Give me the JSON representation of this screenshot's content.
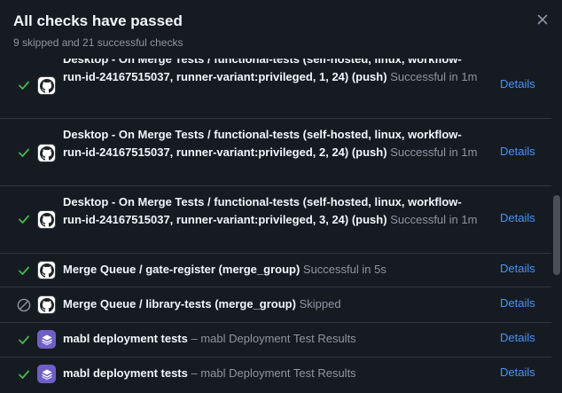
{
  "header": {
    "title": "All checks have passed",
    "subtitle": "9 skipped and 21 successful checks",
    "close_icon": "x-icon"
  },
  "colors": {
    "background": "#161b22",
    "success": "#3fb950",
    "skipped": "#8d96a0",
    "link": "#4493f8",
    "mabl": "#6e5fc7"
  },
  "checks": [
    {
      "status": "success",
      "avatar": "github-icon",
      "name": "Desktop - On Merge Tests / functional-tests (self-hosted, linux, workflow-run-id-24167515037, runner-variant:privileged, 1, 24) (push)",
      "desc": "Successful in 1m",
      "details": "Details"
    },
    {
      "status": "success",
      "avatar": "github-icon",
      "name": "Desktop - On Merge Tests / functional-tests (self-hosted, linux, workflow-run-id-24167515037, runner-variant:privileged, 2, 24) (push)",
      "desc": "Successful in 1m",
      "details": "Details"
    },
    {
      "status": "success",
      "avatar": "github-icon",
      "name": "Desktop - On Merge Tests / functional-tests (self-hosted, linux, workflow-run-id-24167515037, runner-variant:privileged, 3, 24) (push)",
      "desc": "Successful in 1m",
      "details": "Details"
    },
    {
      "status": "success",
      "avatar": "github-icon",
      "name": "Merge Queue / gate-register (merge_group)",
      "desc": "Successful in 5s",
      "details": "Details"
    },
    {
      "status": "skipped",
      "avatar": "github-icon",
      "name": "Merge Queue / library-tests (merge_group)",
      "desc": "Skipped",
      "details": "Details"
    },
    {
      "status": "success",
      "avatar": "mabl-icon",
      "name": "mabl deployment tests",
      "desc": "– mabl Deployment Test Results",
      "details": "Details"
    },
    {
      "status": "success",
      "avatar": "mabl-icon",
      "name": "mabl deployment tests",
      "desc": "– mabl Deployment Test Results",
      "details": "Details"
    }
  ]
}
